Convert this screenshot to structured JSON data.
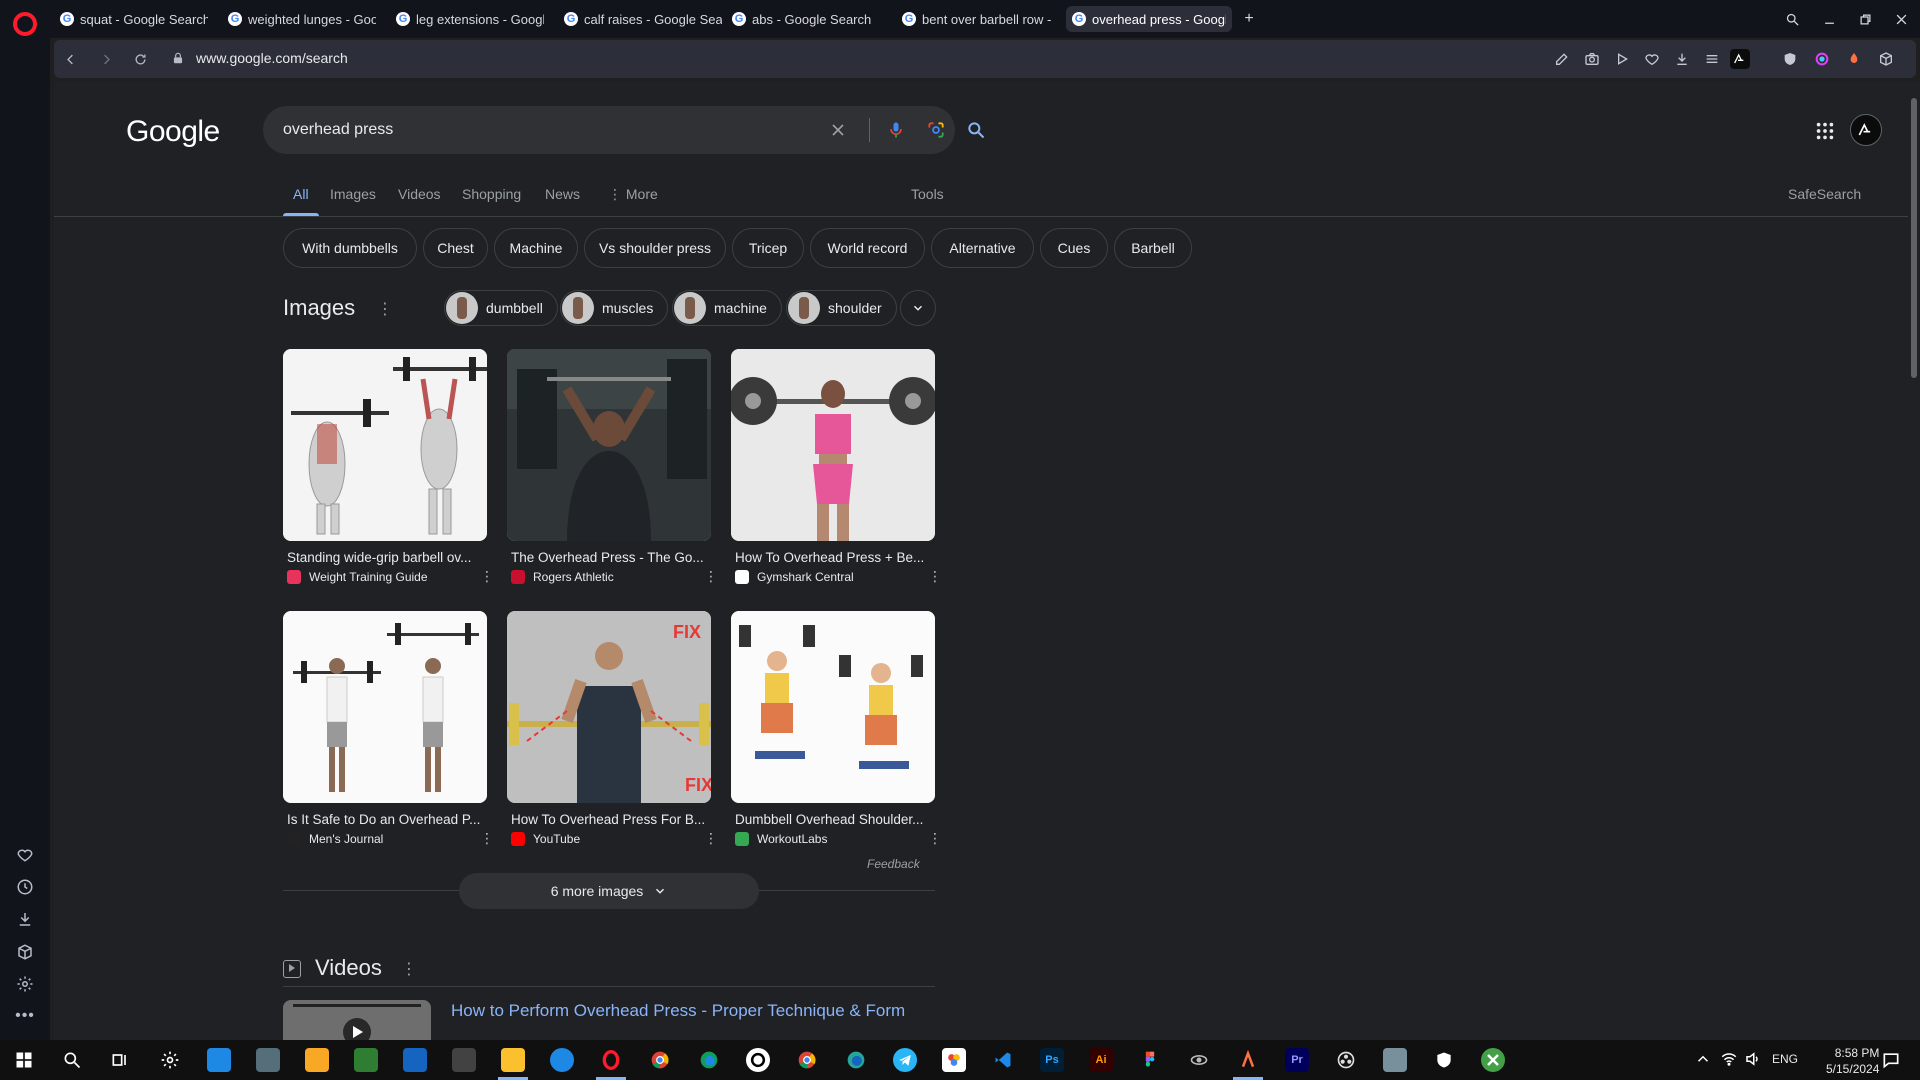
{
  "browser": {
    "tabs": [
      {
        "title": "squat - Google Search"
      },
      {
        "title": "weighted lunges - Google"
      },
      {
        "title": "leg extensions - Google S"
      },
      {
        "title": "calf raises - Google Search"
      },
      {
        "title": "abs - Google Search"
      },
      {
        "title": "bent over barbell row - Go"
      },
      {
        "title": "overhead press - Google S"
      }
    ],
    "url": "www.google.com/search",
    "favicon_letter": "G"
  },
  "google": {
    "logo": "Google",
    "query": "overhead press",
    "nav": [
      "All",
      "Images",
      "Videos",
      "Shopping",
      "News",
      "More"
    ],
    "tools": "Tools",
    "safesearch": "SafeSearch",
    "chips": [
      "With dumbbells",
      "Chest",
      "Machine",
      "Vs shoulder press",
      "Tricep",
      "World record",
      "Alternative",
      "Cues",
      "Barbell"
    ],
    "images_title": "Images",
    "image_chips": [
      "dumbbell",
      "muscles",
      "machine",
      "shoulder"
    ],
    "results": [
      {
        "caption": "Standing wide-grip barbell ov...",
        "source": "Weight Training Guide",
        "fav_color": "#e8335d"
      },
      {
        "caption": "The Overhead Press - The Go...",
        "source": "Rogers Athletic",
        "fav_color": "#c8102e"
      },
      {
        "caption": "How To Overhead Press + Be...",
        "source": "Gymshark Central",
        "fav_color": "#ffffff"
      },
      {
        "caption": "Is It Safe to Do an Overhead P...",
        "source": "Men's Journal",
        "fav_color": "#222222"
      },
      {
        "caption": "How To Overhead Press For B...",
        "source": "YouTube",
        "fav_color": "#ff0000"
      },
      {
        "caption": "Dumbbell Overhead Shoulder...",
        "source": "WorkoutLabs",
        "fav_color": "#34a853"
      }
    ],
    "feedback": "Feedback",
    "more_images": "6 more images",
    "videos_title": "Videos",
    "video_link": "How to Perform Overhead Press - Proper Technique & Form",
    "image_text": {
      "fix": "FIX"
    }
  },
  "taskbar": {
    "lang": "ENG",
    "time": "8:58 PM",
    "date": "5/15/2024"
  },
  "colors": {
    "accent": "#8ab4f8",
    "opera_red": "#ff1b2d",
    "page_bg": "#202124"
  }
}
